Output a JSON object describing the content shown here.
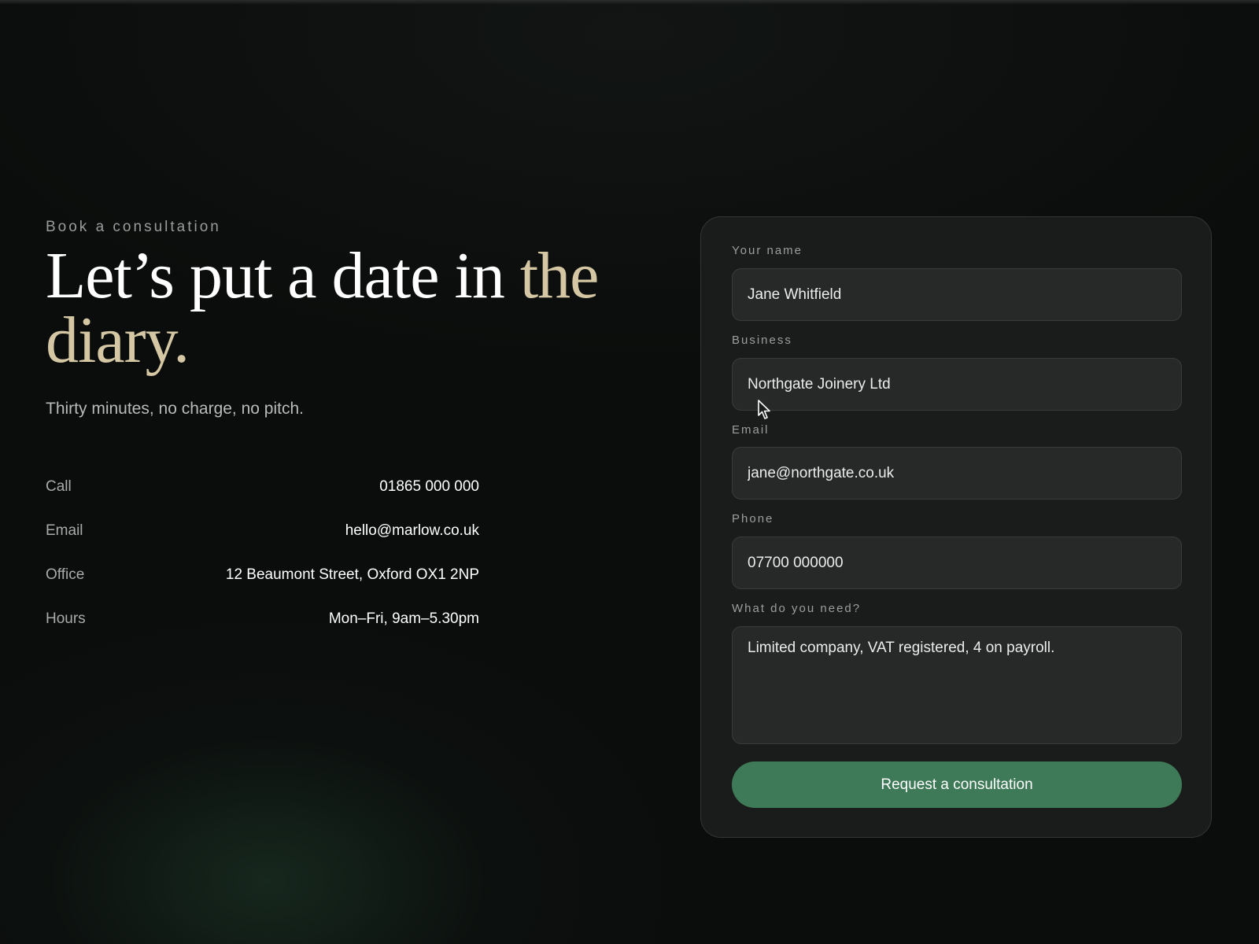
{
  "intro": {
    "eyebrow": "Book a consultation",
    "headline_main": "Let’s put a date in ",
    "headline_accent": "the diary.",
    "subtitle": "Thirty minutes, no charge, no pitch."
  },
  "contact": [
    {
      "label": "Call",
      "value": "01865 000 000"
    },
    {
      "label": "Email",
      "value": "hello@marlow.co.uk"
    },
    {
      "label": "Office",
      "value": "12 Beaumont Street, Oxford OX1 2NP"
    },
    {
      "label": "Hours",
      "value": "Mon–Fri, 9am–5.30pm"
    }
  ],
  "form": {
    "name": {
      "label": "Your name",
      "value": "Jane Whitfield"
    },
    "business": {
      "label": "Business",
      "value": "Northgate Joinery Ltd"
    },
    "email": {
      "label": "Email",
      "value": "jane@northgate.co.uk"
    },
    "phone": {
      "label": "Phone",
      "value": "07700 000000"
    },
    "needs": {
      "label": "What do you need?",
      "value": "Limited company, VAT registered, 4 on payroll."
    },
    "submit_label": "Request a consultation"
  },
  "colors": {
    "background": "#0b0d0c",
    "accent_text": "#d5c7a4",
    "card": "#1a1b1b",
    "input": "#272928",
    "button": "#3e7a57"
  },
  "icons": {
    "cursor": "mouse-pointer-icon"
  }
}
